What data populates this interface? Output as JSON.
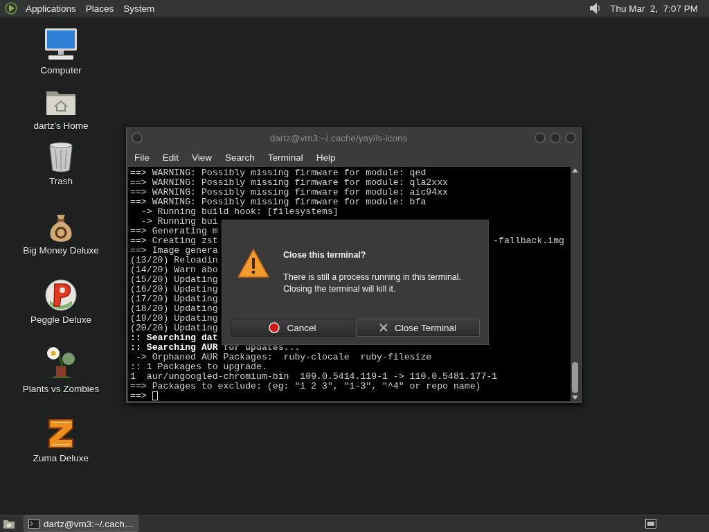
{
  "top_panel": {
    "menus": [
      {
        "label": "Applications"
      },
      {
        "label": "Places"
      },
      {
        "label": "System"
      }
    ],
    "clock": "Thu Mar  2,  7:07 PM"
  },
  "desktop_icons": [
    {
      "label": "Computer",
      "kind": "computer"
    },
    {
      "label": "dartz's Home",
      "kind": "home"
    },
    {
      "label": "Trash",
      "kind": "trash"
    },
    {
      "label": "Big Money Deluxe",
      "kind": "moneybag"
    },
    {
      "label": "Peggle Deluxe",
      "kind": "peggle"
    },
    {
      "label": "Plants vs Zombies",
      "kind": "plant"
    },
    {
      "label": "Zuma Deluxe",
      "kind": "zuma"
    }
  ],
  "terminal": {
    "title": "dartz@vm3:~/.cache/yay/ls-icons",
    "menu": [
      {
        "label": "File"
      },
      {
        "label": "Edit"
      },
      {
        "label": "View"
      },
      {
        "label": "Search"
      },
      {
        "label": "Terminal"
      },
      {
        "label": "Help"
      }
    ],
    "lines": [
      {
        "text": "==> WARNING: Possibly missing firmware for module: qed",
        "bold": false
      },
      {
        "text": "==> WARNING: Possibly missing firmware for module: qla2xxx",
        "bold": false
      },
      {
        "text": "==> WARNING: Possibly missing firmware for module: aic94xx",
        "bold": false
      },
      {
        "text": "==> WARNING: Possibly missing firmware for module: bfa",
        "bold": false
      },
      {
        "text": "  -> Running build hook: [filesystems]",
        "bold": false
      },
      {
        "text": "  -> Running bui",
        "bold": false
      },
      {
        "text": "==> Generating m",
        "bold": false
      },
      {
        "text": "==> Creating zst",
        "tail": "-fallback.img",
        "bold": false
      },
      {
        "text": "==> Image genera",
        "bold": false
      },
      {
        "text": "(13/20) Reloadin",
        "bold": false
      },
      {
        "text": "(14/20) Warn abo",
        "bold": false
      },
      {
        "text": "(15/20) Updating",
        "bold": false
      },
      {
        "text": "(16/20) Updating",
        "bold": false
      },
      {
        "text": "(17/20) Updating",
        "bold": false
      },
      {
        "text": "(18/20) Updating",
        "bold": false
      },
      {
        "text": "(19/20) Updating",
        "bold": false
      },
      {
        "text": "(20/20) Updating",
        "bold": false
      },
      {
        "text": ":: Searching dat",
        "bold": true
      },
      {
        "text": ":: Searching AUR for updates...",
        "bold": true
      },
      {
        "text": " -> Orphaned AUR Packages:  ruby-clocale  ruby-filesize",
        "bold": false
      },
      {
        "text": ":: 1 Packages to upgrade.",
        "bold": false
      },
      {
        "text": "1  aur/ungoogled-chromium-bin  109.0.5414.119-1 -> 110.0.5481.177-1",
        "bold": false
      },
      {
        "text": "==> Packages to exclude: (eg: \"1 2 3\", \"1-3\", \"^4\" or repo name)",
        "bold": false
      },
      {
        "text": "==> ",
        "bold": false,
        "cursor": true
      }
    ]
  },
  "dialog": {
    "title": "Close this terminal?",
    "message": [
      "There is still a process running in this terminal.",
      "Closing the terminal will kill it."
    ],
    "buttons": [
      {
        "label": "Cancel",
        "kind": "cancel"
      },
      {
        "label": "Close Terminal",
        "kind": "close"
      }
    ]
  },
  "taskbar": {
    "items": [
      {
        "label": "dartz@vm3:~/.cach…"
      }
    ]
  }
}
